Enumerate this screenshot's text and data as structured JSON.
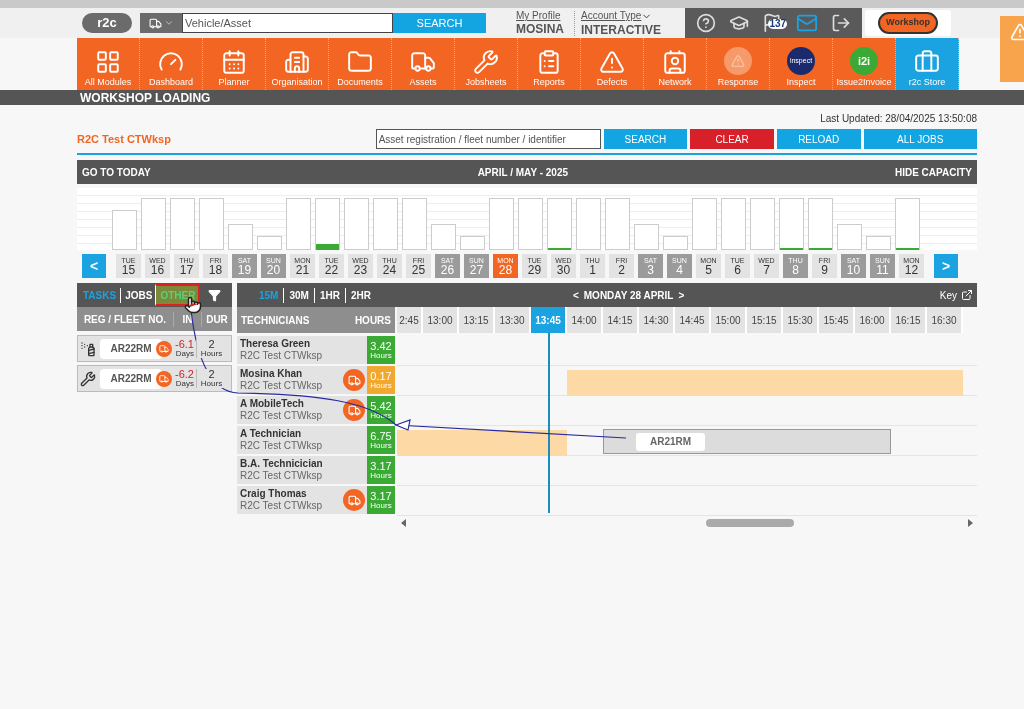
{
  "header": {
    "logo": "r2c",
    "search": {
      "placeholder": "Vehicle/Asset",
      "button": "SEARCH"
    },
    "profile": {
      "link": "My Profile",
      "name": "MOSINA"
    },
    "account": {
      "link": "Account Type",
      "value": "INTERACTIVE"
    },
    "notification_badge": "137",
    "workshop_logo": "Workshop"
  },
  "nav": [
    {
      "label": "All Modules",
      "selected": false
    },
    {
      "label": "Dashboard",
      "selected": false
    },
    {
      "label": "Planner",
      "selected": false
    },
    {
      "label": "Organisation",
      "selected": false
    },
    {
      "label": "Documents",
      "selected": false
    },
    {
      "label": "Assets",
      "selected": false
    },
    {
      "label": "Jobsheets",
      "selected": false
    },
    {
      "label": "Reports",
      "selected": false
    },
    {
      "label": "Defects",
      "selected": false
    },
    {
      "label": "Network",
      "selected": false
    },
    {
      "label": "Response",
      "selected": false
    },
    {
      "label": "Inspect",
      "logo_text": "inspect",
      "selected": false
    },
    {
      "label": "Issue2Invoice",
      "logo_text": "i2i",
      "selected": false
    },
    {
      "label": "r2c Store",
      "selected": true
    }
  ],
  "page_title": "WORKSHOP LOADING",
  "last_updated": "Last Updated: 28/04/2025 13:50:08",
  "workshop_name": "R2C Test CTWksp",
  "asset_search": {
    "placeholder": "Asset registration / fleet number / identifier"
  },
  "actions": [
    {
      "label": "SEARCH",
      "kind": "primary"
    },
    {
      "label": "CLEAR",
      "kind": "danger"
    },
    {
      "label": "RELOAD",
      "kind": "primary"
    },
    {
      "label": "ALL JOBS",
      "kind": "primary"
    }
  ],
  "calendar_bar": {
    "left": "GO TO TODAY",
    "title": "APRIL / MAY - 2025",
    "right": "HIDE CAPACITY"
  },
  "dates": [
    {
      "day": "TUE",
      "num": "15",
      "weekend": false,
      "selected": false
    },
    {
      "day": "WED",
      "num": "16",
      "weekend": false,
      "selected": false
    },
    {
      "day": "THU",
      "num": "17",
      "weekend": false,
      "selected": false
    },
    {
      "day": "FRI",
      "num": "18",
      "weekend": false,
      "selected": false
    },
    {
      "day": "SAT",
      "num": "19",
      "weekend": true,
      "selected": false
    },
    {
      "day": "SUN",
      "num": "20",
      "weekend": true,
      "selected": false
    },
    {
      "day": "MON",
      "num": "21",
      "weekend": false,
      "selected": false
    },
    {
      "day": "TUE",
      "num": "22",
      "weekend": false,
      "selected": false
    },
    {
      "day": "WED",
      "num": "23",
      "weekend": false,
      "selected": false
    },
    {
      "day": "THU",
      "num": "24",
      "weekend": false,
      "selected": false
    },
    {
      "day": "FRI",
      "num": "25",
      "weekend": false,
      "selected": false
    },
    {
      "day": "SAT",
      "num": "26",
      "weekend": true,
      "selected": false
    },
    {
      "day": "SUN",
      "num": "27",
      "weekend": true,
      "selected": false
    },
    {
      "day": "MON",
      "num": "28",
      "weekend": false,
      "selected": true
    },
    {
      "day": "TUE",
      "num": "29",
      "weekend": false,
      "selected": false
    },
    {
      "day": "WED",
      "num": "30",
      "weekend": false,
      "selected": false
    },
    {
      "day": "THU",
      "num": "1",
      "weekend": false,
      "selected": false
    },
    {
      "day": "FRI",
      "num": "2",
      "weekend": false,
      "selected": false
    },
    {
      "day": "SAT",
      "num": "3",
      "weekend": true,
      "selected": false
    },
    {
      "day": "SUN",
      "num": "4",
      "weekend": true,
      "selected": false
    },
    {
      "day": "MON",
      "num": "5",
      "weekend": false,
      "selected": false
    },
    {
      "day": "TUE",
      "num": "6",
      "weekend": false,
      "selected": false
    },
    {
      "day": "WED",
      "num": "7",
      "weekend": false,
      "selected": false
    },
    {
      "day": "THU",
      "num": "8",
      "weekend": true,
      "selected": false
    },
    {
      "day": "FRI",
      "num": "9",
      "weekend": false,
      "selected": false
    },
    {
      "day": "SAT",
      "num": "10",
      "weekend": true,
      "selected": false
    },
    {
      "day": "SUN",
      "num": "11",
      "weekend": true,
      "selected": false
    },
    {
      "day": "MON",
      "num": "12",
      "weekend": false,
      "selected": false
    }
  ],
  "date_nav": {
    "prev": "<",
    "next": ">"
  },
  "list_tabs": [
    {
      "label": "TASKS",
      "selected": true,
      "highlighted": false
    },
    {
      "label": "JOBS",
      "selected": false,
      "highlighted": false
    },
    {
      "label": "OTHER",
      "selected": false,
      "highlighted": true
    }
  ],
  "task_columns": [
    "REG / FLEET NO.",
    "IN",
    "DUR"
  ],
  "tasks": [
    {
      "kind": "spray",
      "reg": "AR22RM",
      "in": "-6.1",
      "in_unit": "Days",
      "dur": "2",
      "dur_unit": "Hours"
    },
    {
      "kind": "tools",
      "reg": "AR22RM",
      "in": "-6.2",
      "in_unit": "Days",
      "dur": "2",
      "dur_unit": "Hours"
    }
  ],
  "scales": [
    {
      "label": "15M",
      "selected": true
    },
    {
      "label": "30M",
      "selected": false
    },
    {
      "label": "1HR",
      "selected": false
    },
    {
      "label": "2HR",
      "selected": false
    }
  ],
  "day_nav": {
    "prev": "<",
    "title": "MONDAY 28 APRIL",
    "next": ">",
    "key": "Key"
  },
  "tech_columns": [
    "TECHNICIANS",
    "HOURS"
  ],
  "times": [
    {
      "label": "2:45",
      "selected": false
    },
    {
      "label": "13:00",
      "selected": false
    },
    {
      "label": "13:15",
      "selected": false
    },
    {
      "label": "13:30",
      "selected": false
    },
    {
      "label": "13:45",
      "selected": true
    },
    {
      "label": "14:00",
      "selected": false
    },
    {
      "label": "14:15",
      "selected": false
    },
    {
      "label": "14:30",
      "selected": false
    },
    {
      "label": "14:45",
      "selected": false
    },
    {
      "label": "15:00",
      "selected": false
    },
    {
      "label": "15:15",
      "selected": false
    },
    {
      "label": "15:30",
      "selected": false
    },
    {
      "label": "15:45",
      "selected": false
    },
    {
      "label": "16:00",
      "selected": false
    },
    {
      "label": "16:15",
      "selected": false
    },
    {
      "label": "16:30",
      "selected": false
    }
  ],
  "technicians": [
    {
      "name": "Theresa Green",
      "workshop": "R2C Test CTWksp",
      "mobile": false,
      "hours": "3.42",
      "unit": "Hours",
      "color": "#3aaa35"
    },
    {
      "name": "Mosina Khan",
      "workshop": "R2C Test CTWksp",
      "mobile": true,
      "hours": "0.17",
      "unit": "Hours",
      "color": "#f0a830",
      "bookings": [
        {
          "kind": "busy"
        }
      ]
    },
    {
      "name": "A MobileTech",
      "workshop": "R2C Test CTWksp",
      "mobile": true,
      "hours": "5.42",
      "unit": "Hours",
      "color": "#3aaa35"
    },
    {
      "name": "A Technician",
      "workshop": "R2C Test CTWksp",
      "mobile": false,
      "hours": "6.75",
      "unit": "Hours",
      "color": "#3aaa35",
      "bookings": [
        {
          "kind": "busy"
        },
        {
          "kind": "job",
          "reg": "AR21RM"
        }
      ]
    },
    {
      "name": "B.A. Technicician",
      "workshop": "R2C Test CTWksp",
      "mobile": false,
      "hours": "3.17",
      "unit": "Hours",
      "color": "#3aaa35"
    },
    {
      "name": "Craig Thomas",
      "workshop": "R2C Test CTWksp",
      "mobile": true,
      "hours": "3.17",
      "unit": "Hours",
      "color": "#3aaa35"
    }
  ]
}
